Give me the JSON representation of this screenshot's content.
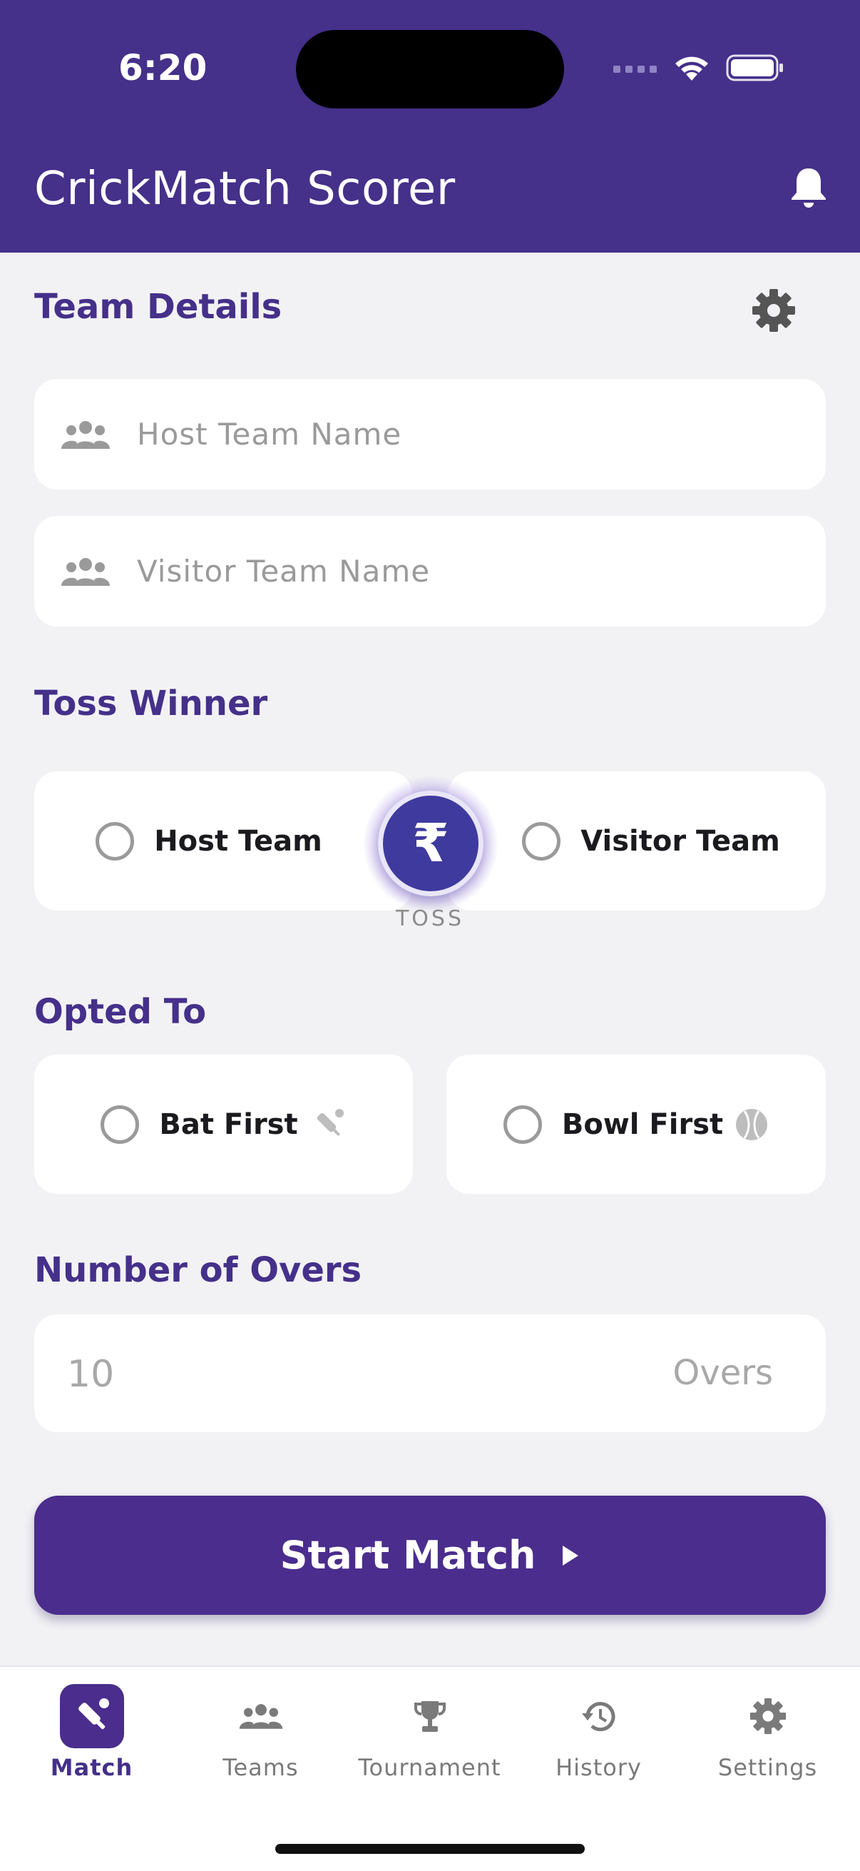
{
  "status_bar": {
    "time": "6:20",
    "icons": [
      "cellular-icon",
      "wifi-icon",
      "battery-icon"
    ]
  },
  "app": {
    "title": "CrickMatch Scorer",
    "brand_color": "#45308a",
    "notification_icon": "bell-icon"
  },
  "team_details": {
    "title": "Team Details",
    "settings_icon": "gear-icon",
    "host_placeholder": "Host Team Name",
    "host_value": "",
    "visitor_placeholder": "Visitor Team Name",
    "visitor_value": "",
    "field_icon": "people-icon"
  },
  "toss": {
    "title": "Toss Winner",
    "options": [
      "Host Team",
      "Visitor Team"
    ],
    "selected": null,
    "button_symbol": "₹",
    "button_caption": "TOSS"
  },
  "opted": {
    "title": "Opted To",
    "options": [
      {
        "label": "Bat First",
        "icon": "cricket-bat-icon"
      },
      {
        "label": "Bowl First",
        "icon": "cricket-ball-icon"
      }
    ],
    "selected": null
  },
  "overs": {
    "title": "Number of Overs",
    "value": "10",
    "unit": "Overs"
  },
  "start_button": {
    "label": "Start Match",
    "icon": "play-icon"
  },
  "tabs": [
    {
      "label": "Match",
      "icon": "cricket-bat-icon",
      "active": true
    },
    {
      "label": "Teams",
      "icon": "people-icon",
      "active": false
    },
    {
      "label": "Tournament",
      "icon": "trophy-icon",
      "active": false
    },
    {
      "label": "History",
      "icon": "history-icon",
      "active": false
    },
    {
      "label": "Settings",
      "icon": "gear-icon",
      "active": false
    }
  ]
}
